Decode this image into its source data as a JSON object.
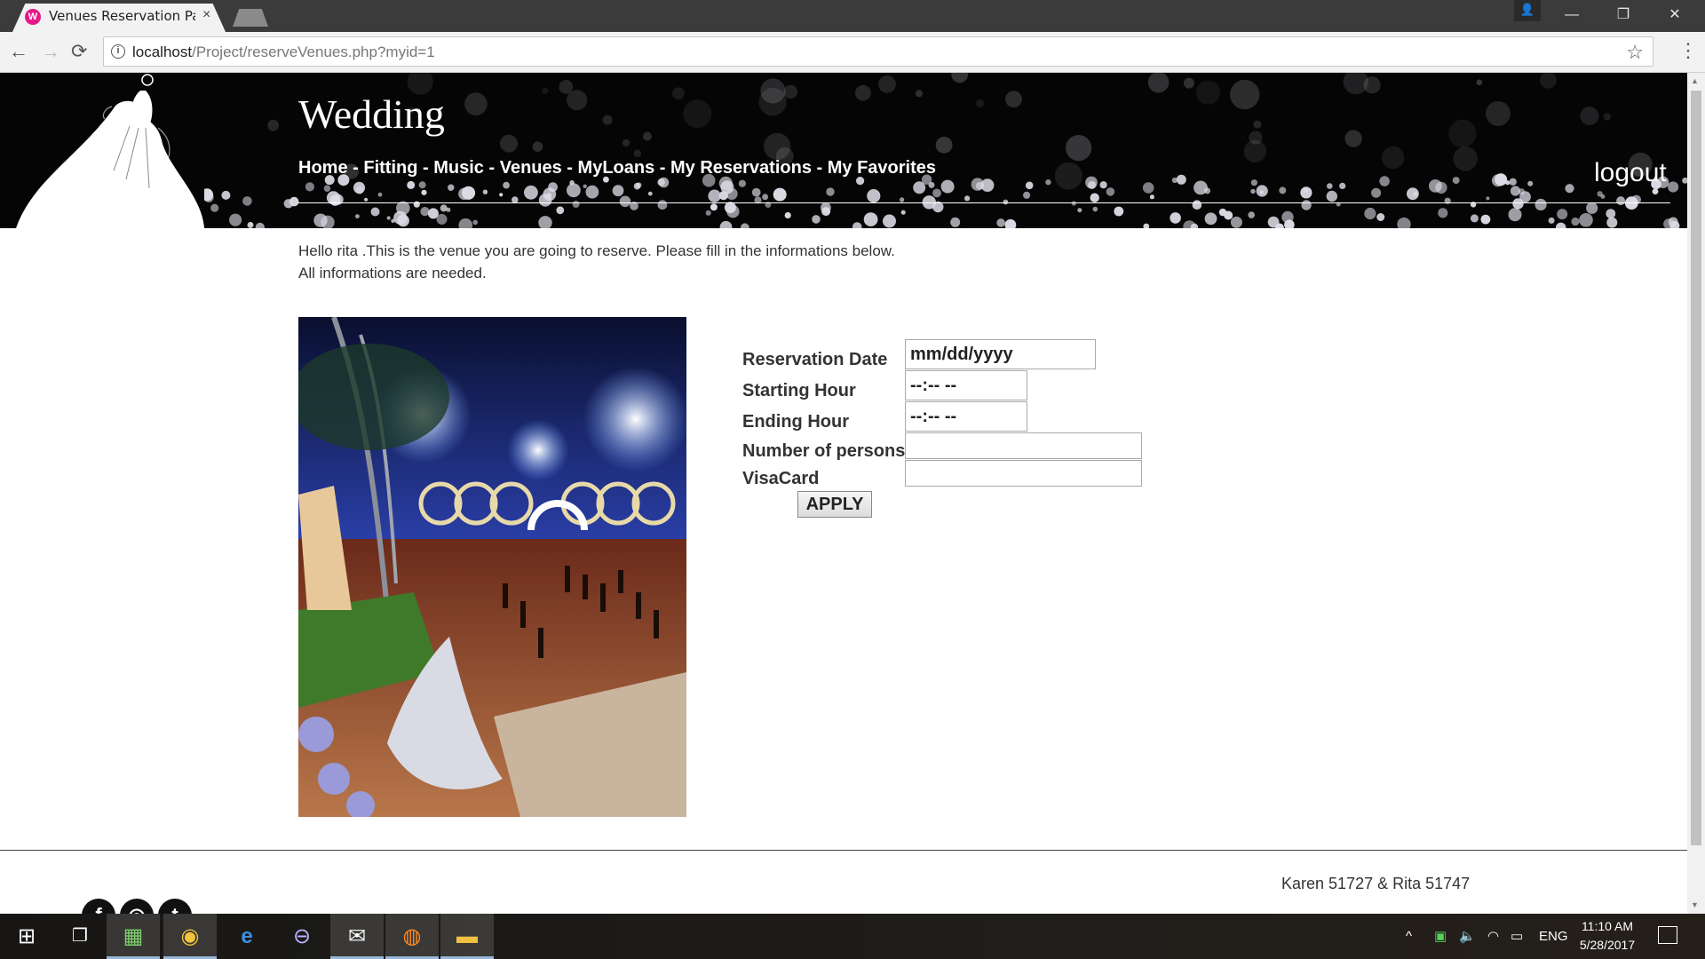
{
  "browser": {
    "tab_title": "Venues Reservation Page",
    "tab_favicon": "W",
    "tab_close": "×",
    "url_host": "localhost",
    "url_path": "/Project/reserveVenues.php?myid=1",
    "icons": {
      "back": "←",
      "forward": "→",
      "reload": "⟳",
      "info": "i",
      "star": "☆",
      "menu": "⋮",
      "user": "👤",
      "minimize": "—",
      "maximize": "❐",
      "close": "✕"
    }
  },
  "header": {
    "site_title": "Wedding",
    "nav": [
      {
        "label": "Home"
      },
      {
        "label": "Fitting"
      },
      {
        "label": "Music"
      },
      {
        "label": "Venues"
      },
      {
        "label": "MyLoans"
      },
      {
        "label": "My Reservations"
      },
      {
        "label": "My Favorites"
      }
    ],
    "nav_separator": " - ",
    "logout_label": "logout"
  },
  "intro": {
    "line1": "Hello rita .This is the venue you are going to reserve. Please fill in the informations below.",
    "line2": "All informations are needed."
  },
  "form": {
    "reservation_date_label": "Reservation Date",
    "reservation_date_value": "mm/dd/yyyy",
    "starting_hour_label": "Starting Hour",
    "starting_hour_value": "--:-- --",
    "ending_hour_label": "Ending Hour",
    "ending_hour_value": "--:-- --",
    "persons_label": "Number of persons",
    "persons_value": "",
    "visacard_label": "VisaCard",
    "visacard_value": "",
    "apply_label": "APPLY"
  },
  "footer": {
    "credits": "Karen 51727 & Rita 51747",
    "social": [
      {
        "name": "facebook-icon",
        "glyph": "f"
      },
      {
        "name": "instagram-icon",
        "glyph": "◎"
      },
      {
        "name": "twitter-icon",
        "glyph": "t"
      }
    ]
  },
  "taskbar": {
    "start_glyph": "⊞",
    "task_view_glyph": "❐",
    "apps": [
      "▦",
      "◉",
      "e",
      "⊖",
      "✉",
      "◍",
      "▬"
    ],
    "tray_up": "^",
    "tray_lang": "ENG",
    "clock_time": "11:10 AM",
    "clock_date": "5/28/2017"
  }
}
